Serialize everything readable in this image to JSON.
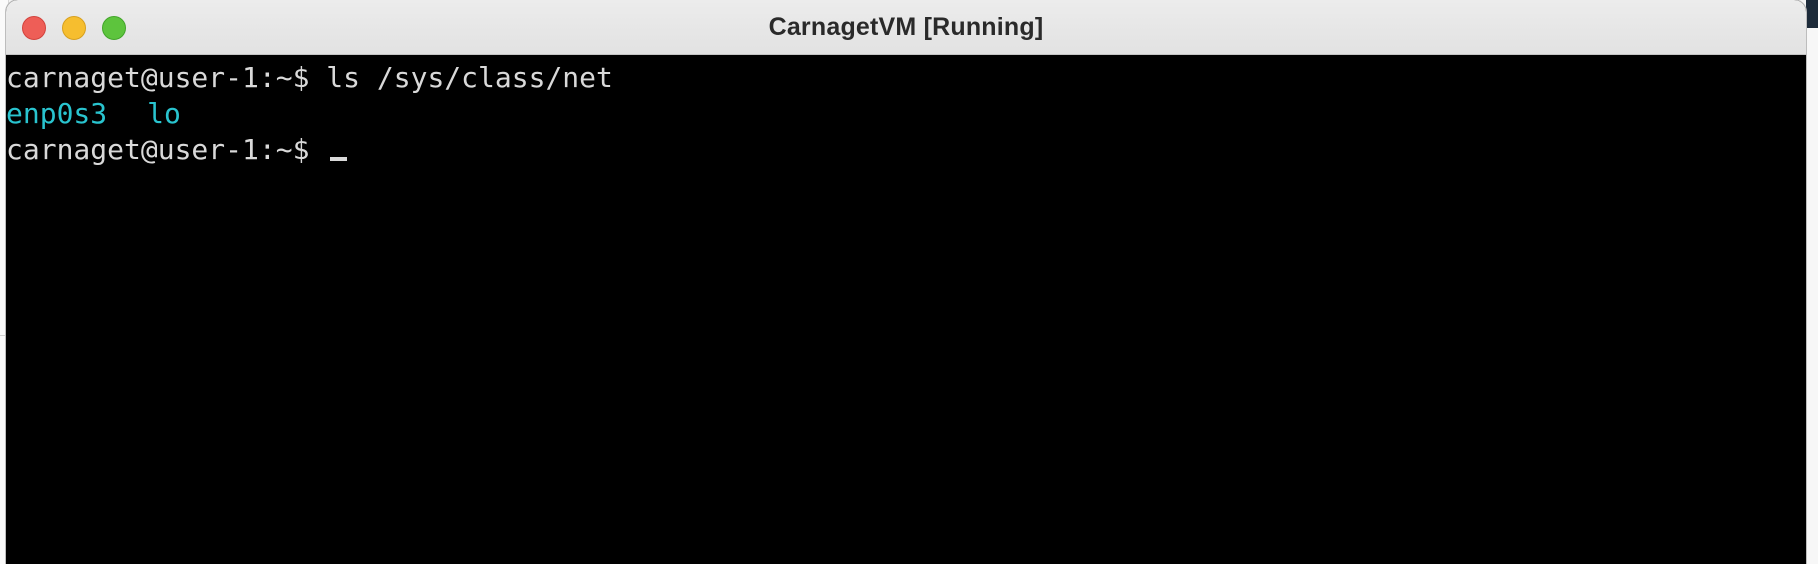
{
  "window": {
    "title": "CarnagetVM [Running]"
  },
  "terminal": {
    "prompt": "carnaget@user-1:~$",
    "lines": [
      {
        "command": "ls /sys/class/net"
      },
      {
        "outputs": [
          "enp0s3",
          "lo"
        ]
      },
      {
        "command": ""
      }
    ]
  },
  "colors": {
    "terminal_bg": "#000000",
    "terminal_fg": "#d9d9d9",
    "directory_listing": "#29c4cf",
    "close": "#ee5e57",
    "minimize": "#f6be2f",
    "zoom": "#5dc43d"
  },
  "icons": {
    "close": "close-dot-icon",
    "minimize": "minimize-dot-icon",
    "zoom": "zoom-dot-icon"
  }
}
